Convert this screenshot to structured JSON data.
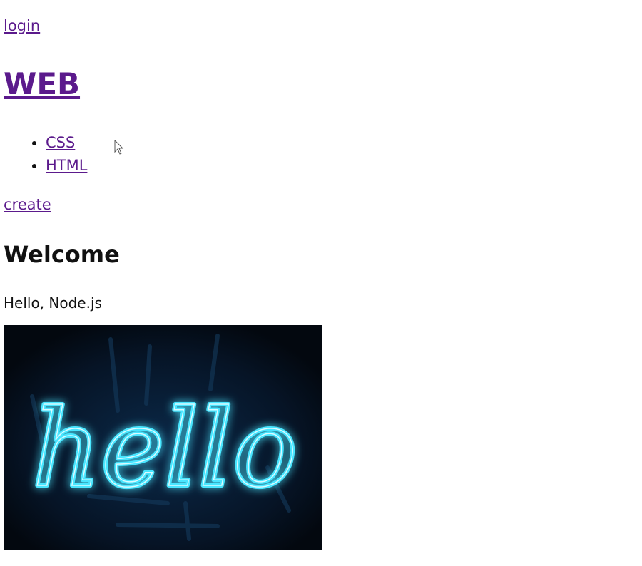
{
  "nav": {
    "login_label": "login",
    "create_label": "create"
  },
  "site": {
    "title": "WEB"
  },
  "topics": [
    {
      "label": "CSS"
    },
    {
      "label": "HTML"
    }
  ],
  "content": {
    "heading": "Welcome",
    "description": "Hello, Node.js"
  },
  "image": {
    "neon_text": "hello",
    "neon_color": "#49e6ff"
  },
  "colors": {
    "link": "#5b1a8c",
    "image_background": "#050e1c"
  }
}
